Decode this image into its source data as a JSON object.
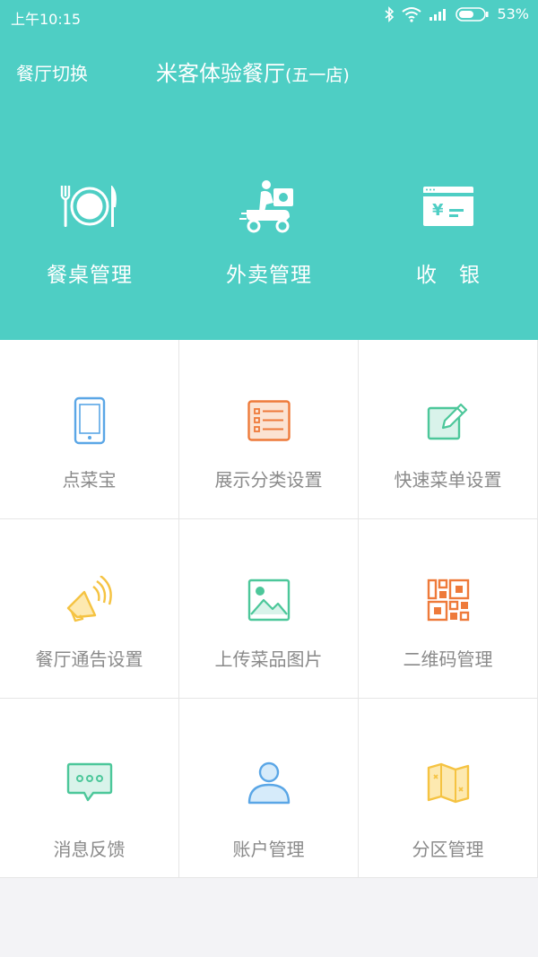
{
  "status": {
    "time": "上午10:15",
    "battery": "53%"
  },
  "header": {
    "switch_label": "餐厅切换",
    "restaurant_name": "米客体验餐厅",
    "branch": "(五一店)"
  },
  "quick_actions": [
    {
      "label": "餐桌管理",
      "icon": "plate-cutlery-icon"
    },
    {
      "label": "外卖管理",
      "icon": "delivery-scooter-icon"
    },
    {
      "label": "收　银",
      "icon": "cashier-card-icon"
    }
  ],
  "menu": [
    {
      "label": "点菜宝",
      "icon": "phone-icon"
    },
    {
      "label": "展示分类设置",
      "icon": "list-icon"
    },
    {
      "label": "快速菜单设置",
      "icon": "edit-icon"
    },
    {
      "label": "餐厅通告设置",
      "icon": "speaker-icon"
    },
    {
      "label": "上传菜品图片",
      "icon": "image-icon"
    },
    {
      "label": "二维码管理",
      "icon": "qrcode-icon"
    },
    {
      "label": "消息反馈",
      "icon": "chat-bubble-icon"
    },
    {
      "label": "账户管理",
      "icon": "user-icon"
    },
    {
      "label": "分区管理",
      "icon": "map-icon"
    }
  ],
  "colors": {
    "header_bg": "#4ecec4",
    "blue": "#5aa6e6",
    "orange": "#ee7a3a",
    "green": "#4cc79a",
    "yellow": "#f5c342",
    "label_gray": "#8a8a8a"
  }
}
